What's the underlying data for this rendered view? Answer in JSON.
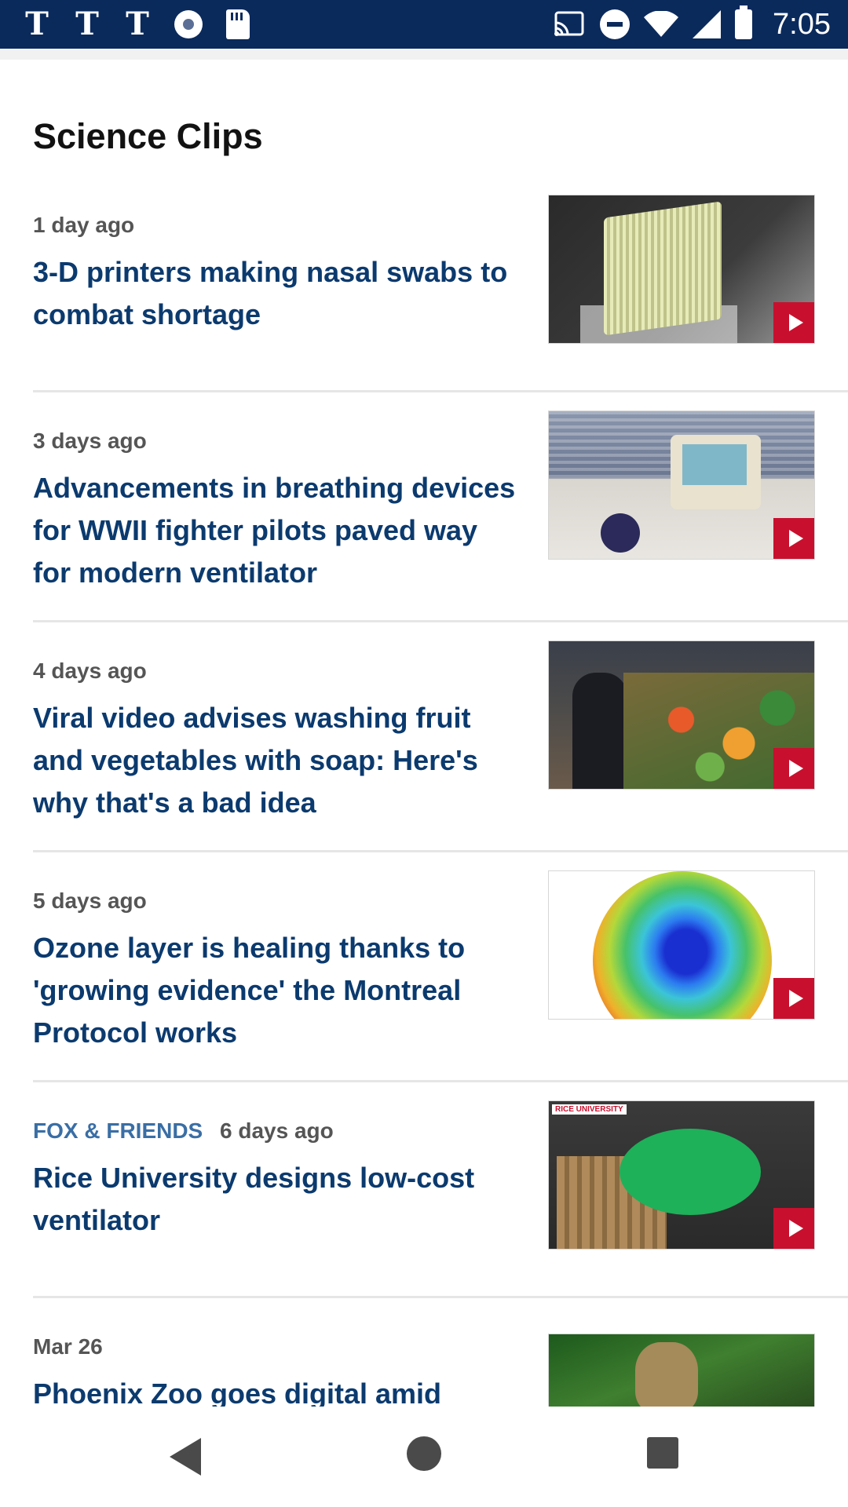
{
  "status_bar": {
    "time": "7:05",
    "left_icons": [
      "nyt-t-icon",
      "nyt-t-icon",
      "nyt-t-icon",
      "radio-icon",
      "sd-card-icon"
    ],
    "nyt_glyph": "𝕿",
    "right_icons": [
      "cast-icon",
      "do-not-disturb-icon",
      "wifi-icon",
      "cellular-signal-icon",
      "battery-icon"
    ]
  },
  "page": {
    "title": "Science Clips"
  },
  "clips": [
    {
      "source": "",
      "age": "1 day ago",
      "headline": "3-D printers making nasal swabs to combat shortage"
    },
    {
      "source": "",
      "age": "3 days ago",
      "headline": "Advancements in breathing devices for WWII fighter pilots paved way for modern ventilator"
    },
    {
      "source": "",
      "age": "4 days ago",
      "headline": "Viral video advises washing fruit and vegetables with soap: Here's why that's a bad idea"
    },
    {
      "source": "",
      "age": "5 days ago",
      "headline": "Ozone layer is healing thanks to 'growing evidence' the Montreal Protocol works"
    },
    {
      "source": "FOX & FRIENDS",
      "age": "6 days ago",
      "headline": "Rice University designs low-cost ventilator",
      "thumb_label": "RICE UNIVERSITY"
    },
    {
      "source": "",
      "age": "Mar 26",
      "headline": "Phoenix Zoo goes digital amid"
    }
  ],
  "nav_bar": {
    "buttons": [
      "back-icon",
      "home-icon",
      "recents-icon"
    ]
  },
  "colors": {
    "status_bar": "#0b2a5c",
    "headline": "#0b3a6e",
    "source": "#3a6ea5",
    "play_badge": "#c8102e"
  }
}
